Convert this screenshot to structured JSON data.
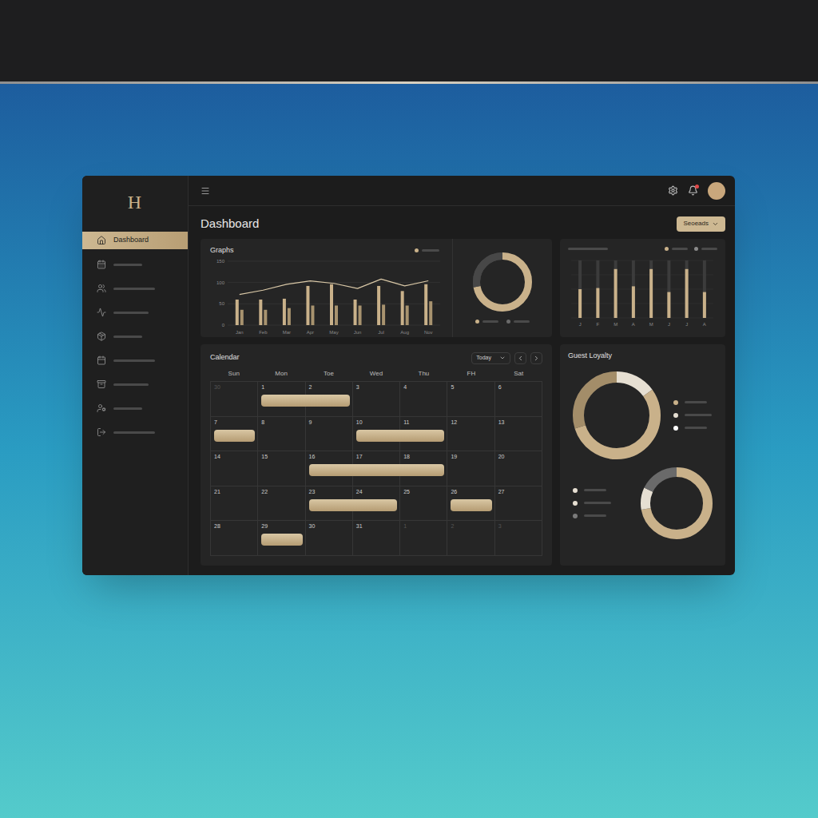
{
  "logo": "H",
  "sidebar": {
    "items": [
      {
        "label": "Dashboard",
        "selected": true
      },
      {
        "selected": false
      },
      {
        "selected": false
      },
      {
        "selected": false
      },
      {
        "selected": false
      },
      {
        "selected": false
      },
      {
        "selected": false
      },
      {
        "selected": false
      },
      {
        "selected": false
      }
    ]
  },
  "topbar": {
    "notification": true
  },
  "page": {
    "title": "Dashboard",
    "filter": "Seoeads"
  },
  "graphs": {
    "title": "Graphs",
    "max": 150,
    "y_ticks": [
      "150",
      "100",
      "50",
      "0"
    ],
    "x_labels": [
      "Jan",
      "Feb",
      "Mar",
      "Apr",
      "May",
      "Jun",
      "Jul",
      "Aug",
      "Nov"
    ],
    "series_tall": [
      60,
      60,
      62,
      92,
      96,
      60,
      92,
      80,
      96
    ],
    "series_short": [
      36,
      36,
      40,
      46,
      46,
      46,
      48,
      46,
      56
    ],
    "line": [
      72,
      82,
      96,
      104,
      98,
      86,
      108,
      92,
      104
    ],
    "donut_level": 0.72
  },
  "weekly": {
    "max": 100,
    "x_labels": [
      "J",
      "F",
      "M",
      "A",
      "M",
      "J",
      "J",
      "A"
    ],
    "values": [
      50,
      52,
      85,
      55,
      85,
      45,
      85,
      45
    ],
    "legend": [
      {
        "color": "#c9b18a"
      },
      {
        "color": "#8a8a8a"
      }
    ]
  },
  "calendar": {
    "title": "Calendar",
    "view": "Today",
    "weekdays": [
      "Sun",
      "Mon",
      "Toe",
      "Wed",
      "Thu",
      "FH",
      "Sat"
    ],
    "weeks": [
      {
        "days": [
          {
            "label": "30",
            "muted": true
          },
          {
            "label": "1",
            "muted": false
          },
          {
            "label": "2",
            "muted": false
          },
          {
            "label": "3",
            "muted": false
          },
          {
            "label": "4",
            "muted": false
          },
          {
            "label": "5",
            "muted": false
          },
          {
            "label": "6",
            "muted": false
          }
        ],
        "events": [
          {
            "start": 1,
            "days": 2
          }
        ]
      },
      {
        "days": [
          {
            "label": "7",
            "muted": false
          },
          {
            "label": "8",
            "muted": false
          },
          {
            "label": "9",
            "muted": false
          },
          {
            "label": "10",
            "muted": false
          },
          {
            "label": "11",
            "muted": false
          },
          {
            "label": "12",
            "muted": false
          },
          {
            "label": "13",
            "muted": false
          }
        ],
        "events": [
          {
            "start": 0,
            "days": 1
          },
          {
            "start": 3,
            "days": 2
          }
        ]
      },
      {
        "days": [
          {
            "label": "14",
            "muted": false
          },
          {
            "label": "15",
            "muted": false
          },
          {
            "label": "16",
            "muted": false
          },
          {
            "label": "17",
            "muted": false
          },
          {
            "label": "18",
            "muted": false
          },
          {
            "label": "19",
            "muted": false
          },
          {
            "label": "20",
            "muted": false
          }
        ],
        "events": [
          {
            "start": 2,
            "days": 3
          }
        ]
      },
      {
        "days": [
          {
            "label": "21",
            "muted": false
          },
          {
            "label": "22",
            "muted": false
          },
          {
            "label": "23",
            "muted": false
          },
          {
            "label": "24",
            "muted": false
          },
          {
            "label": "25",
            "muted": false
          },
          {
            "label": "26",
            "muted": false
          },
          {
            "label": "27",
            "muted": false
          }
        ],
        "events": [
          {
            "start": 2,
            "days": 2
          },
          {
            "start": 5,
            "days": 1
          }
        ]
      },
      {
        "days": [
          {
            "label": "28",
            "muted": false
          },
          {
            "label": "29",
            "muted": false
          },
          {
            "label": "30",
            "muted": false
          },
          {
            "label": "31",
            "muted": false
          },
          {
            "label": "1",
            "muted": true
          },
          {
            "label": "2",
            "muted": true
          },
          {
            "label": "3",
            "muted": true
          }
        ],
        "events": [
          {
            "start": 1,
            "days": 1
          }
        ]
      }
    ]
  },
  "guest_loyalty": {
    "title": "Guest Loyalty",
    "donuts": [
      {
        "segments": [
          {
            "value": 15,
            "color": "#e6dfd2"
          },
          {
            "value": 55,
            "color": "#c9b18a"
          },
          {
            "value": 30,
            "color": "#a38d69"
          }
        ],
        "legend": [
          {
            "color": "#c9b18a"
          },
          {
            "color": "#e6dfd2"
          },
          {
            "color": "#ffffff"
          }
        ]
      },
      {
        "segments": [
          {
            "value": 72,
            "color": "#c9b18a"
          },
          {
            "value": 10,
            "color": "#e6dfd2"
          },
          {
            "value": 18,
            "color": "#6a6a6a"
          }
        ],
        "legend": [
          {
            "color": "#e6dfd2"
          },
          {
            "color": "#e6dfd2"
          },
          {
            "color": "#7a7a7a"
          }
        ]
      }
    ]
  }
}
